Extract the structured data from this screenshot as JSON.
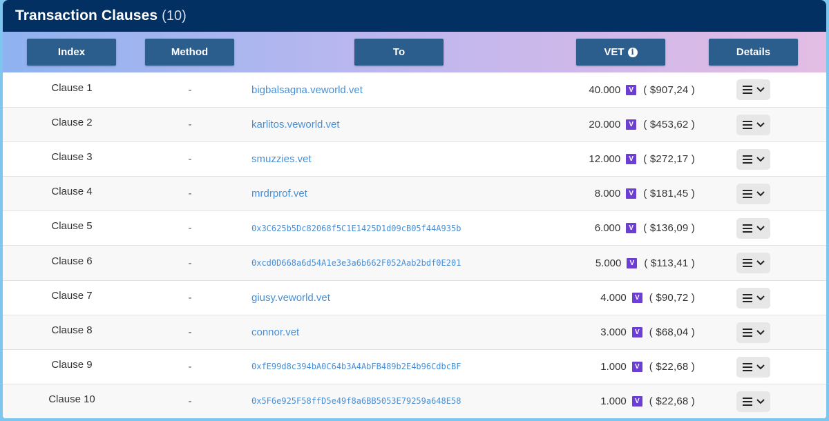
{
  "title": {
    "label": "Transaction Clauses",
    "count": "(10)"
  },
  "columns": {
    "index": "Index",
    "method": "Method",
    "to": "To",
    "vet": "VET",
    "details": "Details"
  },
  "colors": {
    "title_bg": "#023062",
    "header_button": "#2b5d8d",
    "link": "#4a8fd4",
    "vet_token": "#6b3fd4"
  },
  "icons": {
    "info": "info-icon",
    "token": "vet-token-icon",
    "menu": "menu-icon",
    "chevron": "chevron-down-icon"
  },
  "rows": [
    {
      "index": "Clause 1",
      "method": "-",
      "to": "bigbalsagna.veworld.vet",
      "mono": false,
      "vet": "40.000",
      "usd": "( $907,24 )"
    },
    {
      "index": "Clause 2",
      "method": "-",
      "to": "karlitos.veworld.vet",
      "mono": false,
      "vet": "20.000",
      "usd": "( $453,62 )"
    },
    {
      "index": "Clause 3",
      "method": "-",
      "to": "smuzzies.vet",
      "mono": false,
      "vet": "12.000",
      "usd": "( $272,17 )"
    },
    {
      "index": "Clause 4",
      "method": "-",
      "to": "mrdrprof.vet",
      "mono": false,
      "vet": "8.000",
      "usd": "( $181,45 )"
    },
    {
      "index": "Clause 5",
      "method": "-",
      "to": "0x3C625b5Dc82068f5C1E1425D1d09cB05f44A935b",
      "mono": true,
      "vet": "6.000",
      "usd": "( $136,09 )"
    },
    {
      "index": "Clause 6",
      "method": "-",
      "to": "0xcd0D668a6d54A1e3e3a6b662F052Aab2bdf0E201",
      "mono": true,
      "vet": "5.000",
      "usd": "( $113,41 )"
    },
    {
      "index": "Clause 7",
      "method": "-",
      "to": "giusy.veworld.vet",
      "mono": false,
      "vet": "4.000",
      "usd": "( $90,72 )"
    },
    {
      "index": "Clause 8",
      "method": "-",
      "to": "connor.vet",
      "mono": false,
      "vet": "3.000",
      "usd": "( $68,04 )"
    },
    {
      "index": "Clause 9",
      "method": "-",
      "to": "0xfE99d8c394bA0C64b3A4AbFB489b2E4b96CdbcBF",
      "mono": true,
      "vet": "1.000",
      "usd": "( $22,68 )"
    },
    {
      "index": "Clause 10",
      "method": "-",
      "to": "0x5F6e925F58ffD5e49f8a6BB5053E79259a648E58",
      "mono": true,
      "vet": "1.000",
      "usd": "( $22,68 )"
    }
  ]
}
